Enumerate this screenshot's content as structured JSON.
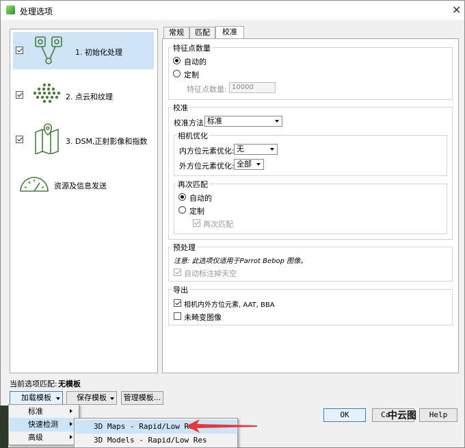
{
  "window": {
    "title": "处理选项"
  },
  "steps": [
    {
      "label": "1. 初始化处理",
      "checked": true,
      "icon": "initial-processing-icon"
    },
    {
      "label": "2. 点云和纹理",
      "checked": true,
      "icon": "point-cloud-icon"
    },
    {
      "label": "3. DSM,正射影像和指数",
      "checked": true,
      "icon": "dsm-map-icon"
    },
    {
      "label": "资源及信息发送",
      "icon": "gauge-icon"
    }
  ],
  "tabs": [
    "常规",
    "匹配",
    "校准"
  ],
  "keypoints": {
    "group_label": "特征点数量",
    "auto_label": "自动的",
    "custom_label": "定制",
    "count_label": "特征点数量:",
    "count_value": "10000"
  },
  "calibration": {
    "group_label": "校准",
    "method_label": "校准方法",
    "method_value": "标准",
    "camera_opt_label": "相机优化",
    "internal_label": "内方位元素优化:",
    "internal_value": "无",
    "external_label": "外方位元素优化:",
    "external_value": "全部",
    "rematch_label": "再次匹配",
    "rematch_auto": "自动的",
    "rematch_custom": "定制",
    "rematch_check": "再次匹配"
  },
  "preprocessing": {
    "group_label": "预处理",
    "note": "注意: 此选项仅适用于Parrot Bebop 图像。",
    "sky_label": "自动标注掉天空"
  },
  "export": {
    "group_label": "导出",
    "camera_params": "相机内外方位元素, AAT, BBA",
    "undistorted": "未畸变图像"
  },
  "template": {
    "current_label": "当前选项匹配:",
    "current_value": "无模板",
    "load_button": "加载模板",
    "save_button": "保存模板",
    "manage_button": "管理模板..."
  },
  "menu": {
    "items": [
      "标准",
      "快速检测",
      "高级"
    ]
  },
  "submenu": {
    "items": [
      "3D Maps - Rapid/Low Res",
      "3D Models - Rapid/Low Res"
    ]
  },
  "buttons": {
    "ok": "OK",
    "cancel": "Ca",
    "help": "Help"
  },
  "watermark": "中云图",
  "colors": {
    "selection": "#cfe4f7",
    "accent_green": "#4a7a3f",
    "arrow_red": "#e53935"
  }
}
